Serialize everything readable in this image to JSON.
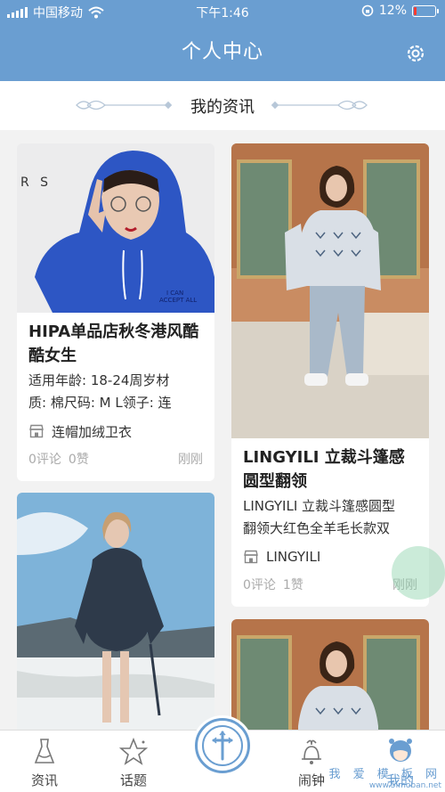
{
  "status_bar": {
    "carrier": "中国移动",
    "time": "下午1:46",
    "battery_text": "12%",
    "battery_level": 0.12
  },
  "header": {
    "title": "个人中心"
  },
  "section": {
    "title": "我的资讯"
  },
  "cards": [
    {
      "title": "HIPA单品店秋冬港风酷酷女生",
      "desc1": "适用年龄: 18-24周岁材",
      "desc2": "质: 棉尺码: M L领子: 连",
      "shop": "连帽加绒卫衣",
      "comments": "0评论",
      "likes": "0赞",
      "time": "刚刚"
    },
    {
      "title": "LINGYILI 立裁斗篷感圆型翻领",
      "desc1": "LINGYILI 立裁斗篷感圆型",
      "desc2": "翻领大红色全羊毛长款双",
      "shop": "LINGYILI",
      "comments": "0评论",
      "likes": "1赞",
      "time": "刚刚"
    }
  ],
  "photo_text": {
    "letters": "R S"
  },
  "tabbar": {
    "tabs": [
      {
        "label": "资讯"
      },
      {
        "label": "话题"
      },
      {
        "label": "闹钟"
      },
      {
        "label": "我的"
      }
    ]
  },
  "watermark": {
    "line1": "我 爱 模 板 网",
    "line2": "www.5imoban.net"
  },
  "colors": {
    "primary": "#6a9ed1",
    "battery_low": "#ff3b30"
  }
}
